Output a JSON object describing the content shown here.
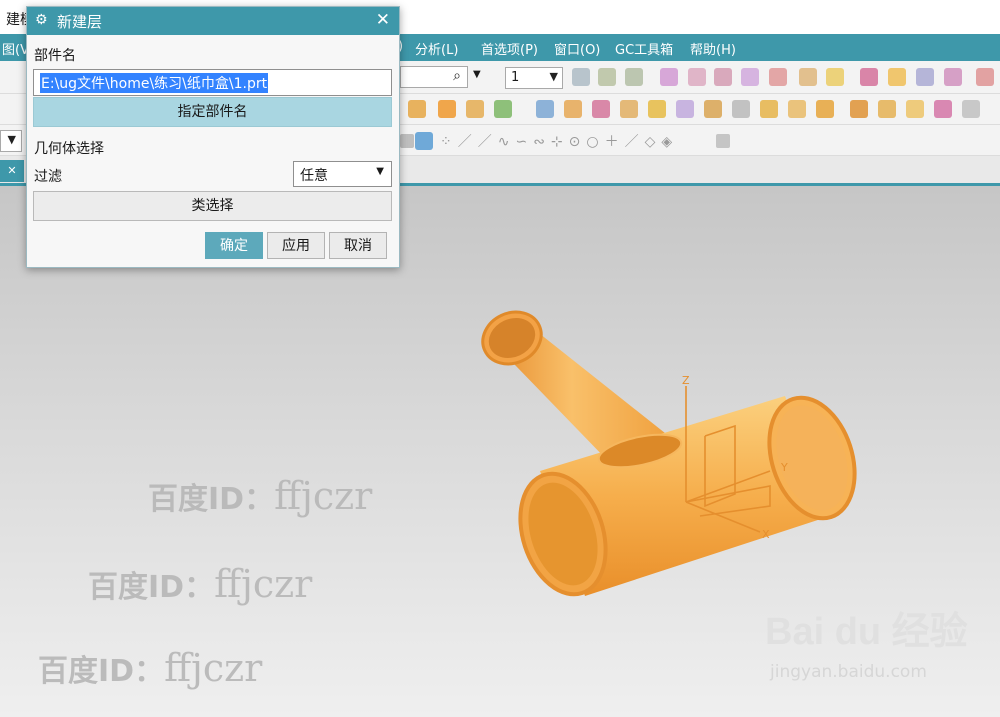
{
  "app": {
    "title_fragment": "建模",
    "menu_partial_left": "图(V)",
    "menu_partial_mid": ")",
    "menus": [
      "分析(L)",
      "首选项(P)",
      "窗口(O)",
      "GC工具箱",
      "帮助(H)"
    ]
  },
  "toolbar": {
    "layer_value": "1",
    "search_glyph": "⌕"
  },
  "dialog": {
    "title": "新建层",
    "section_part_name": "部件名",
    "part_path": "E:\\ug文件\\home\\练习\\纸巾盒\\1.prt",
    "specify_button": "指定部件名",
    "section_geometry": "几何体选择",
    "filter_label": "过滤",
    "filter_value": "任意",
    "class_select_button": "类选择",
    "ok": "确定",
    "apply": "应用",
    "cancel": "取消"
  },
  "viewport": {
    "axis_x": "X",
    "axis_y": "Y",
    "axis_z": "Z",
    "model_color": "#f4a646",
    "watermarks": [
      {
        "a": "百度ID：",
        "b": "ffjczr"
      },
      {
        "a": "百度ID：",
        "b": "ffjczr"
      },
      {
        "a": "百度ID：",
        "b": "ffjczr"
      }
    ],
    "baidu_logo": "Bai du 经验",
    "baidu_site": "jingyan.baidu.com"
  }
}
